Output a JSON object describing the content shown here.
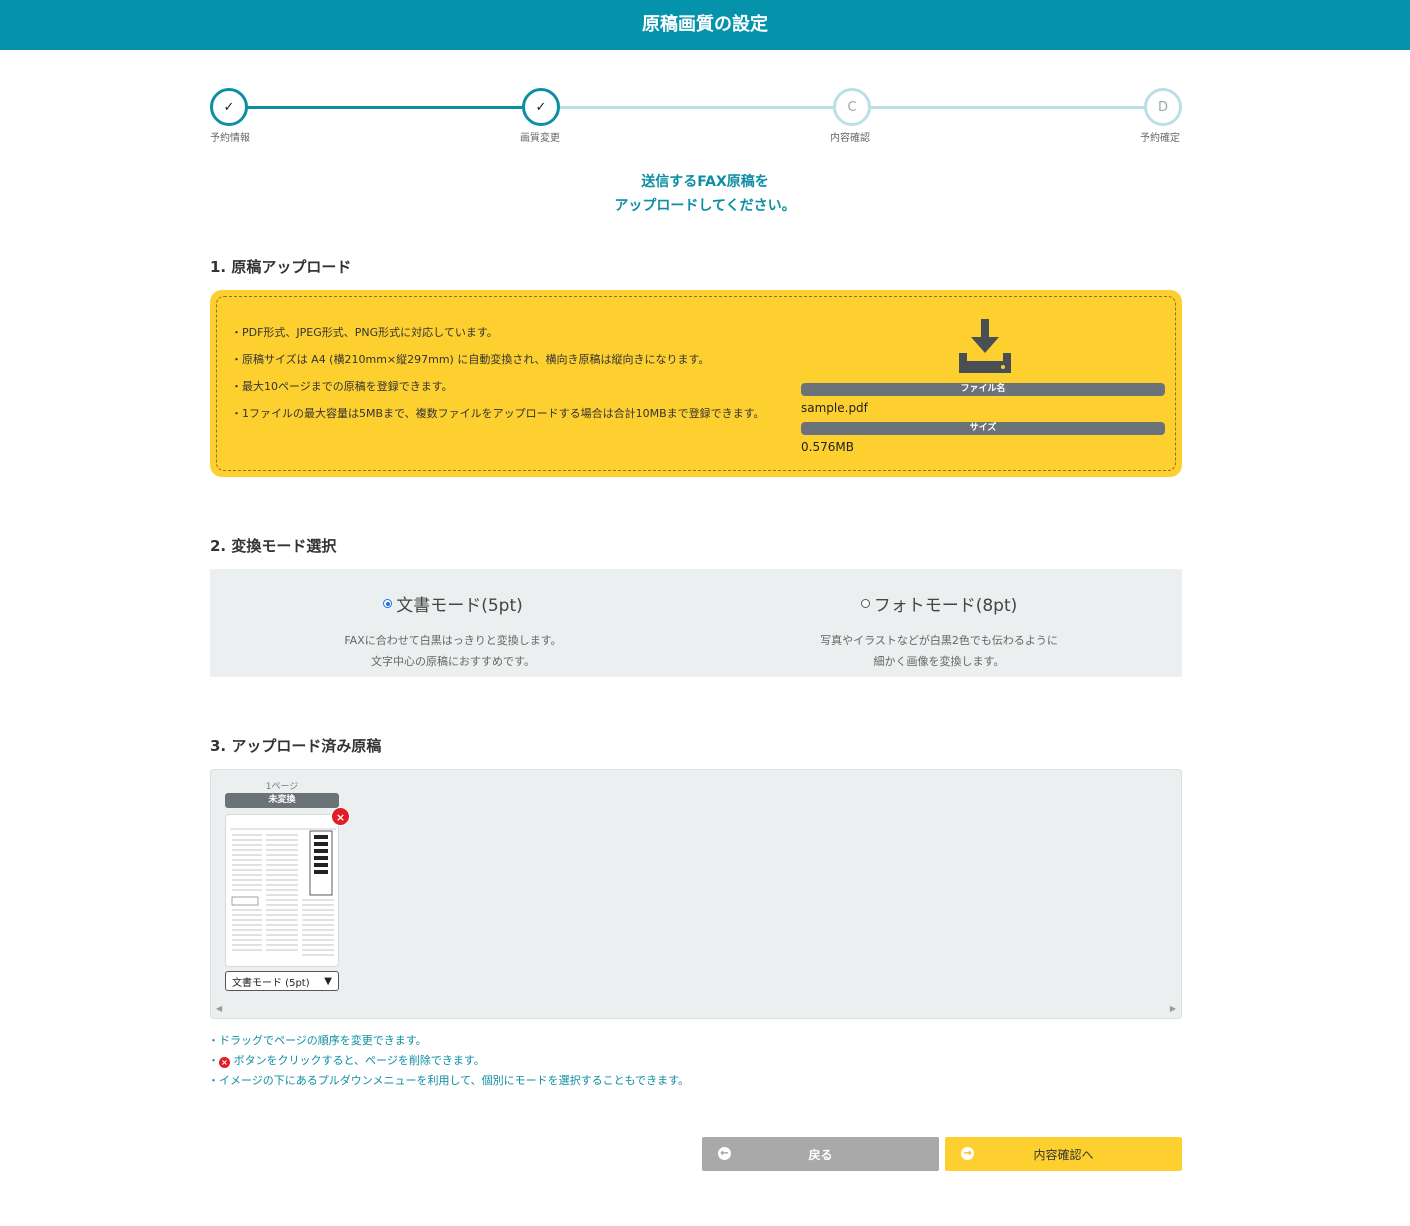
{
  "header": {
    "title": "原稿画質の設定"
  },
  "stepper": {
    "steps": [
      {
        "mark": "✓",
        "label": "予約情報",
        "state": "done"
      },
      {
        "mark": "✓",
        "label": "画質変更",
        "state": "done"
      },
      {
        "mark": "C",
        "label": "内容確認",
        "state": "todo"
      },
      {
        "mark": "D",
        "label": "予約確定",
        "state": "todo"
      }
    ]
  },
  "intro": {
    "line1": "送信するFAX原稿を",
    "line2": "アップロードしてください。"
  },
  "upload": {
    "section_title": "1. 原稿アップロード",
    "notes": [
      "・PDF形式、JPEG形式、PNG形式に対応しています。",
      "・原稿サイズは A4 (横210mm×縦297mm) に自動変換され、横向き原稿は縦向きになります。",
      "・最大10ページまでの原稿を登録できます。",
      "・1ファイルの最大容量は5MBまで、複数ファイルをアップロードする場合は合計10MBまで登録できます。"
    ],
    "icon": "download-icon",
    "file_name_label": "ファイル名",
    "file_name": "sample.pdf",
    "size_label": "サイズ",
    "size": "0.576MB"
  },
  "mode": {
    "section_title": "2. 変換モード選択",
    "options": [
      {
        "title": "文書モード(5pt)",
        "desc1": "FAXに合わせて白黒はっきりと変換します。",
        "desc2": "文字中心の原稿におすすめです。",
        "selected": true
      },
      {
        "title": "フォトモード(8pt)",
        "desc1": "写真やイラストなどが白黒2色でも伝わるように",
        "desc2": "細かく画像を変換します。",
        "selected": false
      }
    ]
  },
  "pages": {
    "section_title": "3. アップロード済み原稿",
    "items": [
      {
        "label": "1ページ",
        "status": "未変換",
        "mode": "文書モード (5pt)",
        "thumb_title": "ネットリアル通信"
      }
    ]
  },
  "hints": {
    "line1": "・ドラッグでページの順序を変更できます。",
    "line2_prefix": "・",
    "line2_text": "ボタンをクリックすると、ページを削除できます。",
    "line3": "・イメージの下にあるプルダウンメニューを利用して、個別にモードを選択することもできます。"
  },
  "buttons": {
    "back": "戻る",
    "next": "内容確認へ"
  },
  "colors": {
    "teal": "#0593ab",
    "yellow": "#fdd030",
    "red": "#e11e27",
    "gray": "#6b7278"
  }
}
